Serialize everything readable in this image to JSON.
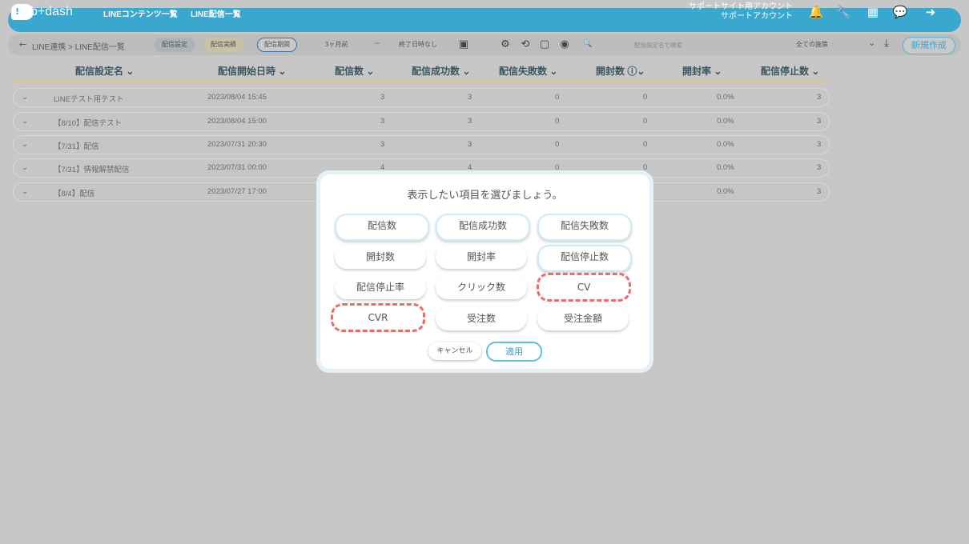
{
  "header": {
    "logo_mark": "!",
    "logo_text": "b+dash",
    "nav": [
      "LINEコンテンツ一覧",
      "LINE配信一覧"
    ],
    "account_line1": "サポートサイト用アカウント",
    "account_line2": "サポートアカウント",
    "icons": [
      "bell-icon",
      "wrench-icon",
      "grid-icon",
      "chat-icon",
      "logout-icon"
    ],
    "glyphs": {
      "bell": "🔔",
      "wrench": "🔧",
      "grid": "▦",
      "chat": "💬",
      "logout": "➜"
    }
  },
  "toolbar": {
    "back": "←",
    "breadcrumb": "LINE連携 > LINE配信一覧",
    "tab_settings": "配信設定",
    "tab_results": "配信実績",
    "period_label": "配信期間",
    "period_from": "3ヶ月前",
    "period_sep": "~",
    "period_to": "終了日時なし",
    "calendar": "▣",
    "search_placeholder": "配信設定名で検索",
    "search_glyph": "🔍",
    "select_value": "全ての施策",
    "select_arrow": "⌄",
    "download": "⤓",
    "new_button": "新規作成",
    "icon_glyphs": {
      "settings": "⚙",
      "history": "⟲",
      "copy": "▢",
      "view": "◉"
    }
  },
  "table": {
    "headers": [
      "配信設定名 ⌄",
      "配信開始日時 ⌄",
      "配信数 ⌄",
      "配信成功数 ⌄",
      "配信失敗数 ⌄",
      "開封数 ⓘ⌄",
      "開封率 ⌄",
      "配信停止数 ⌄"
    ],
    "rows": [
      {
        "name": "LINEテスト用テスト",
        "date": "2023/08/04 15:45",
        "sent": "3",
        "success": "3",
        "fail": "0",
        "opens": "0",
        "rate": "0.0%",
        "stops": "3"
      },
      {
        "name": "【8/10】配信テスト",
        "date": "2023/08/04 15:00",
        "sent": "3",
        "success": "3",
        "fail": "0",
        "opens": "0",
        "rate": "0.0%",
        "stops": "3"
      },
      {
        "name": "【7/31】配信",
        "date": "2023/07/31 20:30",
        "sent": "3",
        "success": "3",
        "fail": "0",
        "opens": "0",
        "rate": "0.0%",
        "stops": "3"
      },
      {
        "name": "【7/31】情報解禁配信",
        "date": "2023/07/31 00:00",
        "sent": "4",
        "success": "4",
        "fail": "0",
        "opens": "0",
        "rate": "0.0%",
        "stops": "3"
      },
      {
        "name": "【8/4】配信",
        "date": "2023/07/27 17:00",
        "sent": "",
        "success": "",
        "fail": "",
        "opens": "",
        "rate": "0.0%",
        "stops": "3"
      }
    ],
    "expand_glyph": "⌄"
  },
  "dialog": {
    "title": "表示したい項目を選びましょう。",
    "options": [
      "配信数",
      "配信成功数",
      "配信失敗数",
      "開封数",
      "開封率",
      "配信停止数",
      "配信停止率",
      "クリック数",
      "CV",
      "CVR",
      "受注数",
      "受注金額"
    ],
    "cancel": "キャンセル",
    "apply": "適用"
  }
}
